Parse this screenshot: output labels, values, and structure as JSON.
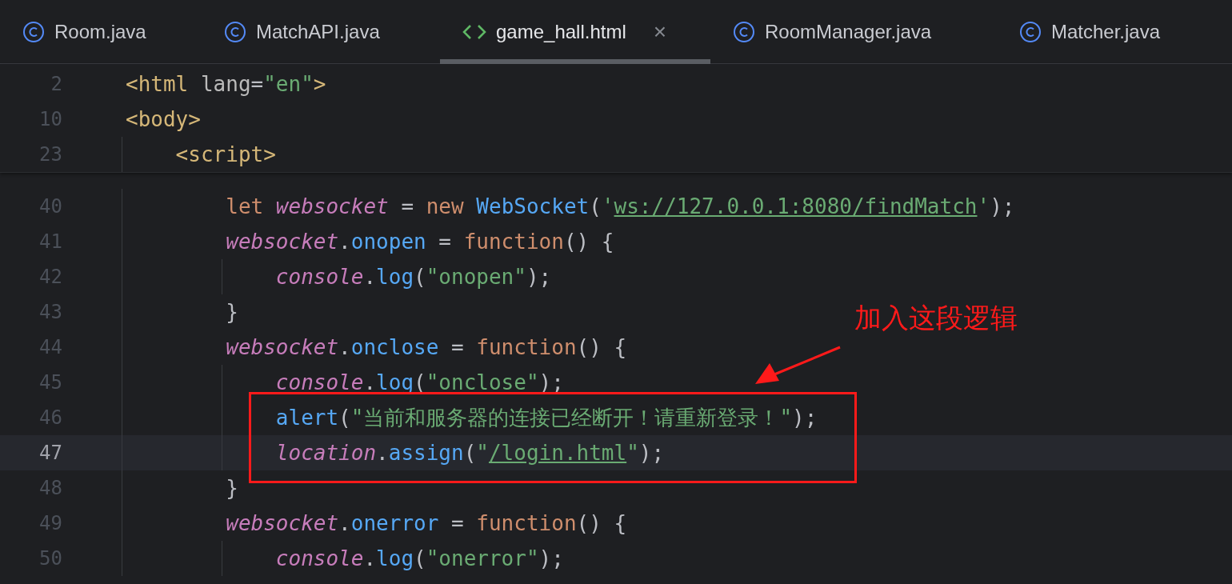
{
  "tabs": [
    {
      "kind": "java",
      "label": "Room.java",
      "selected": false
    },
    {
      "kind": "java",
      "label": "MatchAPI.java",
      "selected": false
    },
    {
      "kind": "html",
      "label": "game_hall.html",
      "selected": true,
      "close": "×"
    },
    {
      "kind": "java",
      "label": "RoomManager.java",
      "selected": false
    },
    {
      "kind": "java",
      "label": "Matcher.java",
      "selected": false
    }
  ],
  "sticky_lines": [
    {
      "number": "2",
      "current": false,
      "tokens": [
        {
          "kind": "tag",
          "text": "<html "
        },
        {
          "kind": "attr",
          "text": "lang"
        },
        {
          "kind": "plain",
          "text": "="
        },
        {
          "kind": "string",
          "text": "\"en\""
        },
        {
          "kind": "tag",
          "text": ">"
        }
      ]
    },
    {
      "number": "10",
      "current": false,
      "tokens": [
        {
          "kind": "tag",
          "text": "<body>"
        }
      ]
    },
    {
      "number": "23",
      "current": false,
      "tokens": [
        {
          "kind": "tag",
          "text": "    <script>"
        }
      ]
    }
  ],
  "lines": [
    {
      "number": "40",
      "current": false,
      "tokens": [
        {
          "kind": "keyword",
          "text": "        let "
        },
        {
          "kind": "var",
          "text": "websocket"
        },
        {
          "kind": "plain",
          "text": " = "
        },
        {
          "kind": "keyword",
          "text": "new "
        },
        {
          "kind": "func",
          "text": "WebSocket"
        },
        {
          "kind": "plain",
          "text": "("
        },
        {
          "kind": "string",
          "text": "'"
        },
        {
          "kind": "link",
          "text": "ws://127.0.0.1:8080/findMatch"
        },
        {
          "kind": "string",
          "text": "'"
        },
        {
          "kind": "plain",
          "text": ");"
        }
      ]
    },
    {
      "number": "41",
      "current": false,
      "tokens": [
        {
          "kind": "var",
          "text": "        websocket"
        },
        {
          "kind": "plain",
          "text": "."
        },
        {
          "kind": "field",
          "text": "onopen"
        },
        {
          "kind": "plain",
          "text": " = "
        },
        {
          "kind": "keyword",
          "text": "function"
        },
        {
          "kind": "plain",
          "text": "() {"
        }
      ]
    },
    {
      "number": "42",
      "current": false,
      "tokens": [
        {
          "kind": "var",
          "text": "            console"
        },
        {
          "kind": "plain",
          "text": "."
        },
        {
          "kind": "func",
          "text": "log"
        },
        {
          "kind": "plain",
          "text": "("
        },
        {
          "kind": "string",
          "text": "\"onopen\""
        },
        {
          "kind": "plain",
          "text": ");"
        }
      ]
    },
    {
      "number": "43",
      "current": false,
      "tokens": [
        {
          "kind": "plain",
          "text": "        }"
        }
      ]
    },
    {
      "number": "44",
      "current": false,
      "tokens": [
        {
          "kind": "var",
          "text": "        websocket"
        },
        {
          "kind": "plain",
          "text": "."
        },
        {
          "kind": "field",
          "text": "onclose"
        },
        {
          "kind": "plain",
          "text": " = "
        },
        {
          "kind": "keyword",
          "text": "function"
        },
        {
          "kind": "plain",
          "text": "() {"
        }
      ]
    },
    {
      "number": "45",
      "current": false,
      "tokens": [
        {
          "kind": "var",
          "text": "            console"
        },
        {
          "kind": "plain",
          "text": "."
        },
        {
          "kind": "func",
          "text": "log"
        },
        {
          "kind": "plain",
          "text": "("
        },
        {
          "kind": "string",
          "text": "\"onclose\""
        },
        {
          "kind": "plain",
          "text": ");"
        }
      ]
    },
    {
      "number": "46",
      "current": false,
      "tokens": [
        {
          "kind": "func",
          "text": "            alert"
        },
        {
          "kind": "plain",
          "text": "("
        },
        {
          "kind": "string",
          "text": "\"当前和服务器的连接已经断开！请重新登录！\""
        },
        {
          "kind": "plain",
          "text": ");"
        }
      ]
    },
    {
      "number": "47",
      "current": true,
      "tokens": [
        {
          "kind": "var",
          "text": "            location"
        },
        {
          "kind": "plain",
          "text": "."
        },
        {
          "kind": "func",
          "text": "assign"
        },
        {
          "kind": "plain",
          "text": "("
        },
        {
          "kind": "string",
          "text": "\""
        },
        {
          "kind": "link",
          "text": "/login.html"
        },
        {
          "kind": "string",
          "text": "\""
        },
        {
          "kind": "plain",
          "text": ");"
        }
      ]
    },
    {
      "number": "48",
      "current": false,
      "tokens": [
        {
          "kind": "plain",
          "text": "        }"
        }
      ]
    },
    {
      "number": "49",
      "current": false,
      "tokens": [
        {
          "kind": "var",
          "text": "        websocket"
        },
        {
          "kind": "plain",
          "text": "."
        },
        {
          "kind": "field",
          "text": "onerror"
        },
        {
          "kind": "plain",
          "text": " = "
        },
        {
          "kind": "keyword",
          "text": "function"
        },
        {
          "kind": "plain",
          "text": "() {"
        }
      ]
    },
    {
      "number": "50",
      "current": false,
      "tokens": [
        {
          "kind": "var",
          "text": "            console"
        },
        {
          "kind": "plain",
          "text": "."
        },
        {
          "kind": "func",
          "text": "log"
        },
        {
          "kind": "plain",
          "text": "("
        },
        {
          "kind": "string",
          "text": "\"onerror\""
        },
        {
          "kind": "plain",
          "text": ");"
        }
      ]
    }
  ],
  "annotation": {
    "text": "加入这段逻辑"
  }
}
